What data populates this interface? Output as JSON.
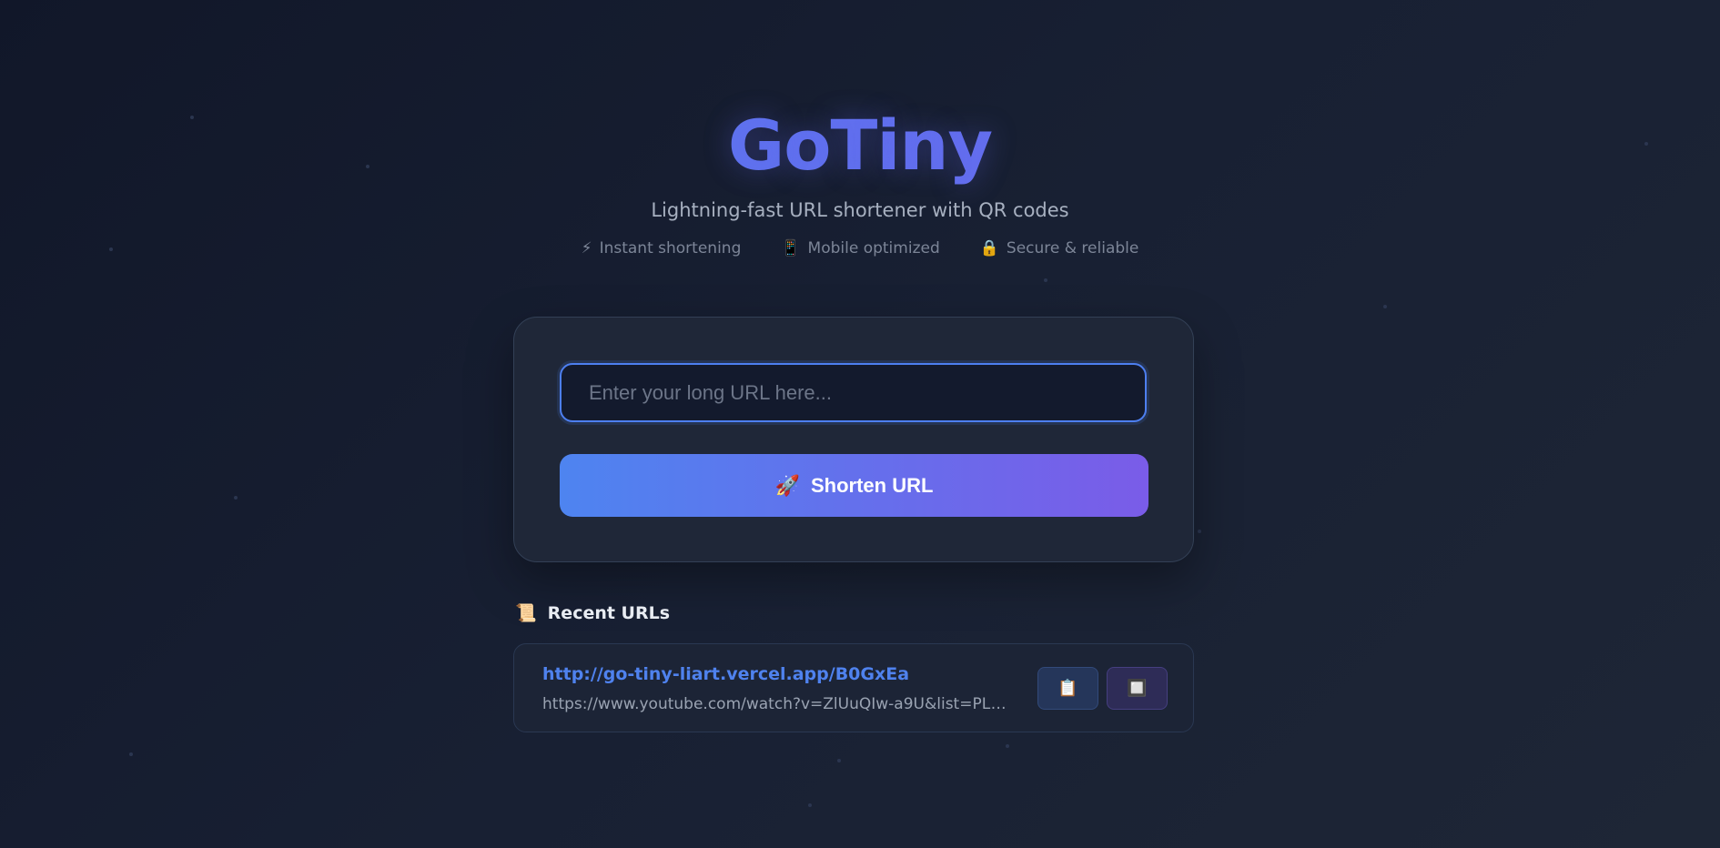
{
  "header": {
    "title": "GoTiny",
    "subtitle": "Lightning-fast URL shortener with QR codes",
    "features": [
      {
        "icon": "⚡",
        "label": "Instant shortening"
      },
      {
        "icon": "📱",
        "label": "Mobile optimized"
      },
      {
        "icon": "🔒",
        "label": "Secure & reliable"
      }
    ]
  },
  "form": {
    "placeholder": "Enter your long URL here...",
    "value": "",
    "button_icon": "🚀",
    "button_label": "Shorten URL"
  },
  "recent": {
    "icon": "📜",
    "title": "Recent URLs",
    "items": [
      {
        "short_url": "http://go-tiny-liart.vercel.app/B0GxEa",
        "original_url": "https://www.youtube.com/watch?v=ZlUuQIw-a9U&list=PLA3Gk...",
        "copy_icon": "📋",
        "qr_icon": "🔲"
      }
    ]
  }
}
